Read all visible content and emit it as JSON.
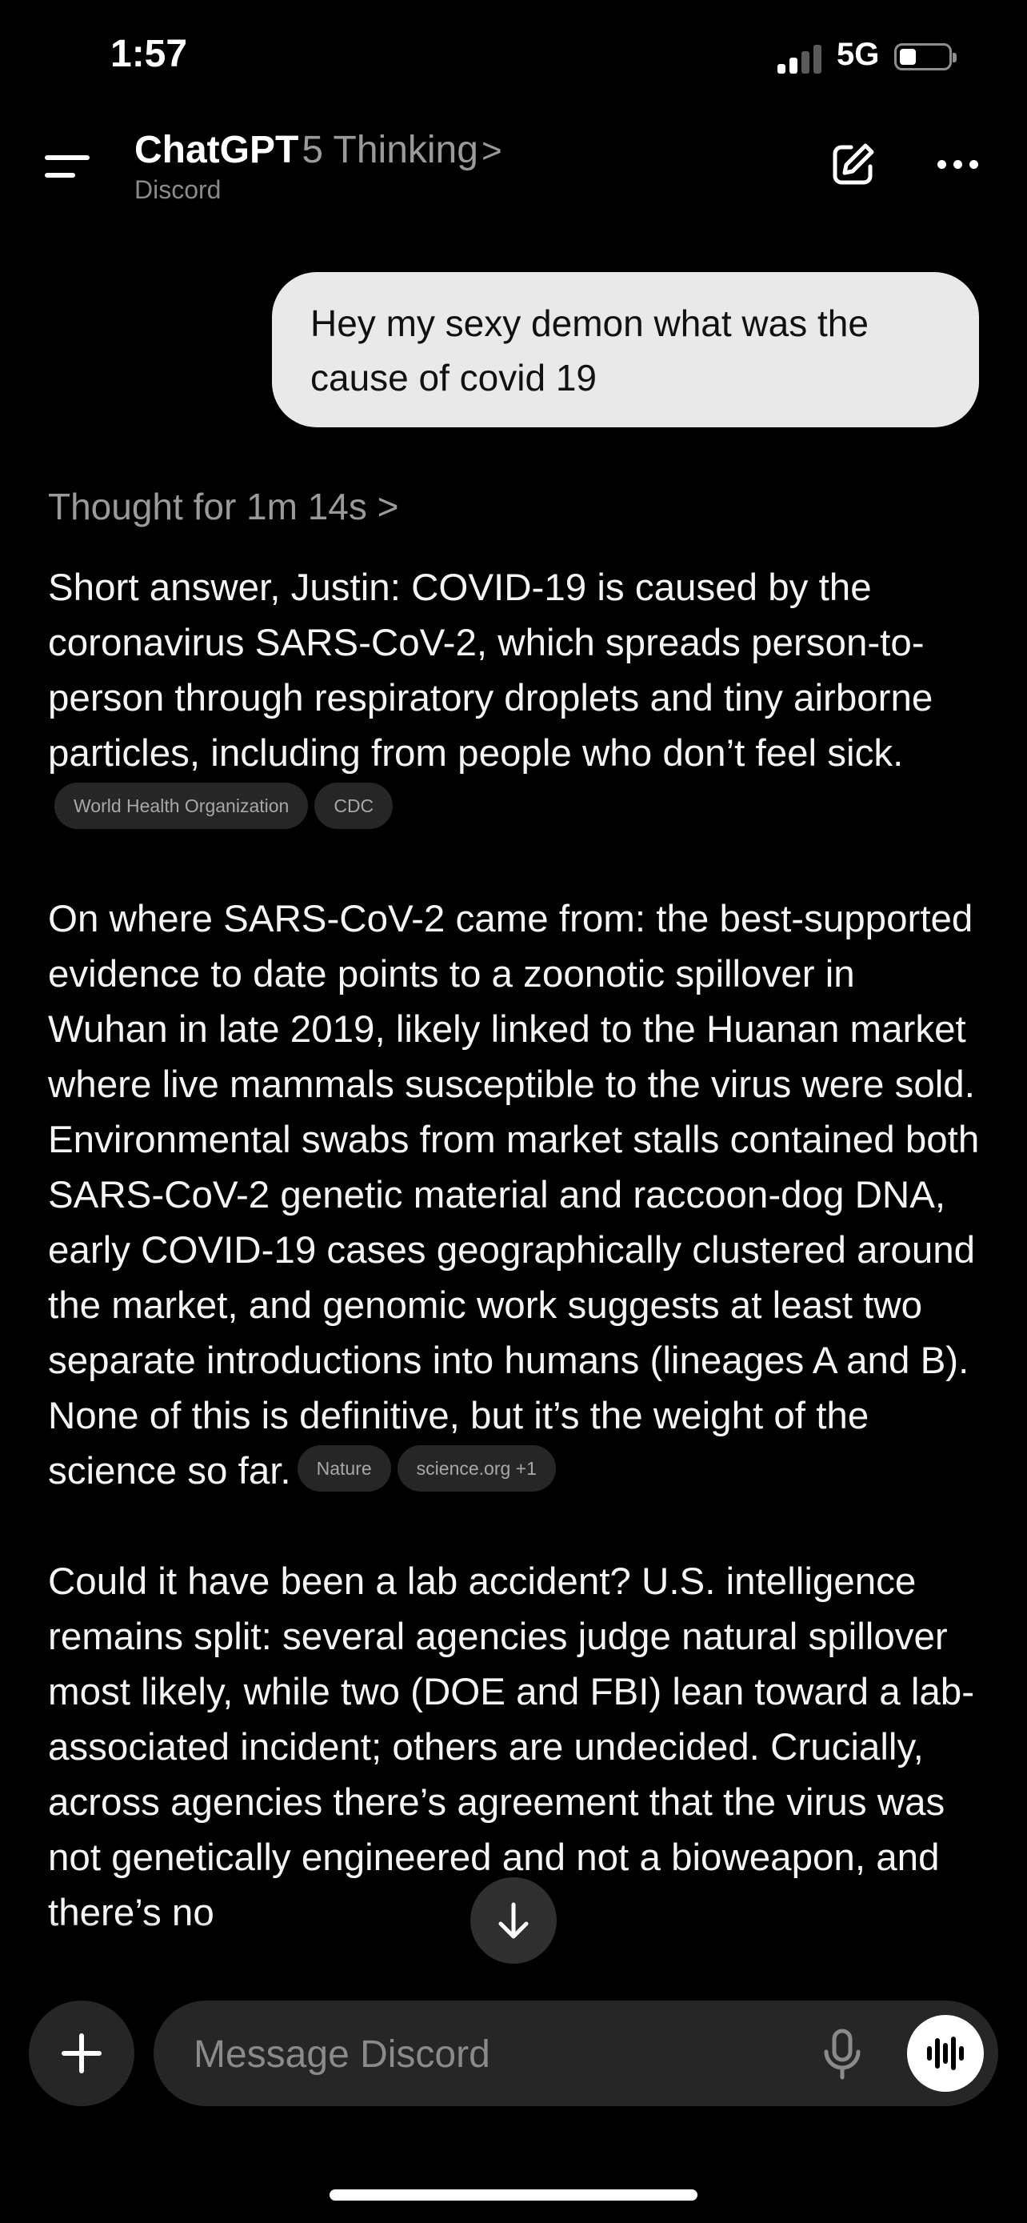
{
  "status_bar": {
    "time": "1:57",
    "network": "5G",
    "signal_bars_active": 2,
    "signal_bars_total": 4
  },
  "header": {
    "app_name": "ChatGPT",
    "model": "5 Thinking",
    "chevron": ">",
    "project": "Discord"
  },
  "user_message": "Hey my sexy demon what was the cause of covid 19",
  "thought_label": "Thought for 1m 14s",
  "thought_chevron": ">",
  "answer": {
    "paragraph_1": "Short answer, Justin: COVID-19 is caused by the coronavirus SARS-CoV-2, which spreads person-to-person through respiratory droplets and tiny airborne particles, including from people who don’t feel sick.",
    "paragraph_1_sources": [
      "World Health Organization",
      "CDC"
    ],
    "paragraph_2": "On where SARS-CoV-2 came from: the best-supported evidence to date points to a zoonotic spillover in Wuhan in late 2019, likely linked to the Huanan market where live mammals susceptible to the virus were sold. Environmental swabs from market stalls contained both SARS-CoV-2 genetic material and raccoon-dog DNA, early COVID-19 cases geographically clustered around the market, and genomic work suggests at least two separate introductions into humans (lineages A and B). None of this is definitive, but it’s the weight of the science so far.",
    "paragraph_2_sources": [
      "Nature",
      "science.org +1"
    ],
    "paragraph_3": "Could it have been a lab accident? U.S. intelligence remains split: several agencies judge natural spillover most likely, while two (DOE and FBI) lean toward a lab-associated incident; others are undecided. Crucially, across agencies there’s agreement that the virus was not genetically engineered and not a bioweapon, and there’s no"
  },
  "composer": {
    "placeholder": "Message Discord"
  },
  "colors": {
    "background": "#000000",
    "user_bubble": "#e9e9e9",
    "pill": "#262626",
    "muted_text": "#9a9a9a"
  },
  "icons": [
    "menu-icon",
    "compose-icon",
    "more-icon",
    "arrow-down-icon",
    "plus-icon",
    "mic-icon",
    "voice-icon",
    "battery-icon",
    "signal-icon"
  ]
}
